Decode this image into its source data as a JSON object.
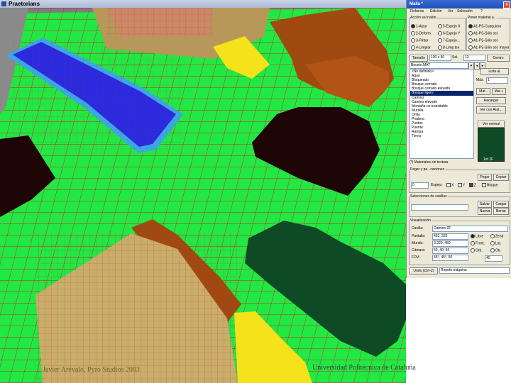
{
  "app": {
    "title": "Praetorians"
  },
  "scene": {
    "colors": {
      "grass": "#22e843",
      "grid": "#c8232a",
      "water": "#2a2ae0",
      "water_edge": "#3aa8e6",
      "sand": "#c9ad6a",
      "dark_soil": "#1f0606",
      "dark_green": "#0f4a27",
      "yellow": "#f6e21b",
      "brown_wall": "#a04a12",
      "gray": "#7a7a7a"
    }
  },
  "panel": {
    "title": "Malla *",
    "menu": [
      "Ficheros",
      "Edición",
      "Ver",
      "Selección",
      "?"
    ],
    "group_accion": {
      "title": "Acción sel.nalón",
      "options": [
        "1-Alzar",
        "5-Espejo X",
        "2-Deform",
        "6-Espejo Y",
        "3-Pintar",
        "7-Espejo...",
        "4-Limpiar",
        "8-Limp.tex"
      ]
    },
    "group_poner": {
      "title": "Poner material a...",
      "options": [
        "A1-PS-Cuaquiera",
        "A1-PS-Sólo sel.",
        "A1-PS-Sólo sel.",
        "A1-PS-Sólo sel. mayor"
      ]
    },
    "size_row": {
      "label": "Tamaño",
      "value": "100 x 50",
      "sel_label": "Sel.",
      "sel_value": "13",
      "center_button": "Centro"
    },
    "material_combo": "Boceto.MAT",
    "list_button": "Lista al.",
    "max_label": "Máx.",
    "min_label": "Mín.",
    "max_value": "1",
    "mat_buttons": [
      "Mat -",
      "Mat +",
      "Mat -",
      "Mat +"
    ],
    "materials": [
      "<No definido>",
      "Agua",
      "Bloqueado",
      "Bosque cerrado",
      "Bosque cerrado elevado",
      "Bosque ligero",
      "Camino",
      "Camino elevado",
      "Montaña no transitable",
      "Muralla",
      "Orilla",
      "Pradera",
      "Puntos",
      "Puente",
      "Rampa",
      "Tierra"
    ],
    "selected_material_index": 5,
    "buttons_mid": [
      "Recargar",
      "Ver con Arat..."
    ],
    "swatch_label": "Ver normal",
    "swatch_caption": "1of 2F",
    "textures_note": "(*) Materiales sin textura",
    "group_pegar": {
      "title": "Pegar y pe...caciones",
      "copy_button": "Copiar",
      "paste_button": "Pegar",
      "value": "0",
      "espejo_label": "Espejo:",
      "x_label": "X",
      "y_label": "Y",
      "z_label": "Z",
      "bloque_label": "Bloque"
    },
    "group_selecciones": {
      "title": "Selecciones de casillas",
      "save_button": "Salvar",
      "load_button": "Cargar",
      "new_button": "Nueva",
      "delete_button": "Borrar"
    },
    "group_visualizacion": {
      "title": "Visualización",
      "rows": [
        {
          "label": "Casilla:",
          "value": "Camino 0F"
        },
        {
          "label": "Pantalla:",
          "value": "462, 225"
        },
        {
          "label": "Mundo:",
          "value": "3.920, 450"
        },
        {
          "label": "Cámara:",
          "value": "50, 40, 50"
        },
        {
          "label": "FOV:",
          "value": "45°, 45°, 50"
        }
      ],
      "radios": [
        "Libre",
        "Zenit",
        "Front.",
        "Lat.",
        "Orb.",
        "Otr."
      ],
      "fps_value": "40"
    },
    "undo_button": "Undo (Ctrl-Z)",
    "repeat_button": "Repetir máquina"
  },
  "footer": {
    "left": "Javier Arévalo, Pyro Studios 2003",
    "right": "Universidad Politécnica de Cataluña"
  }
}
